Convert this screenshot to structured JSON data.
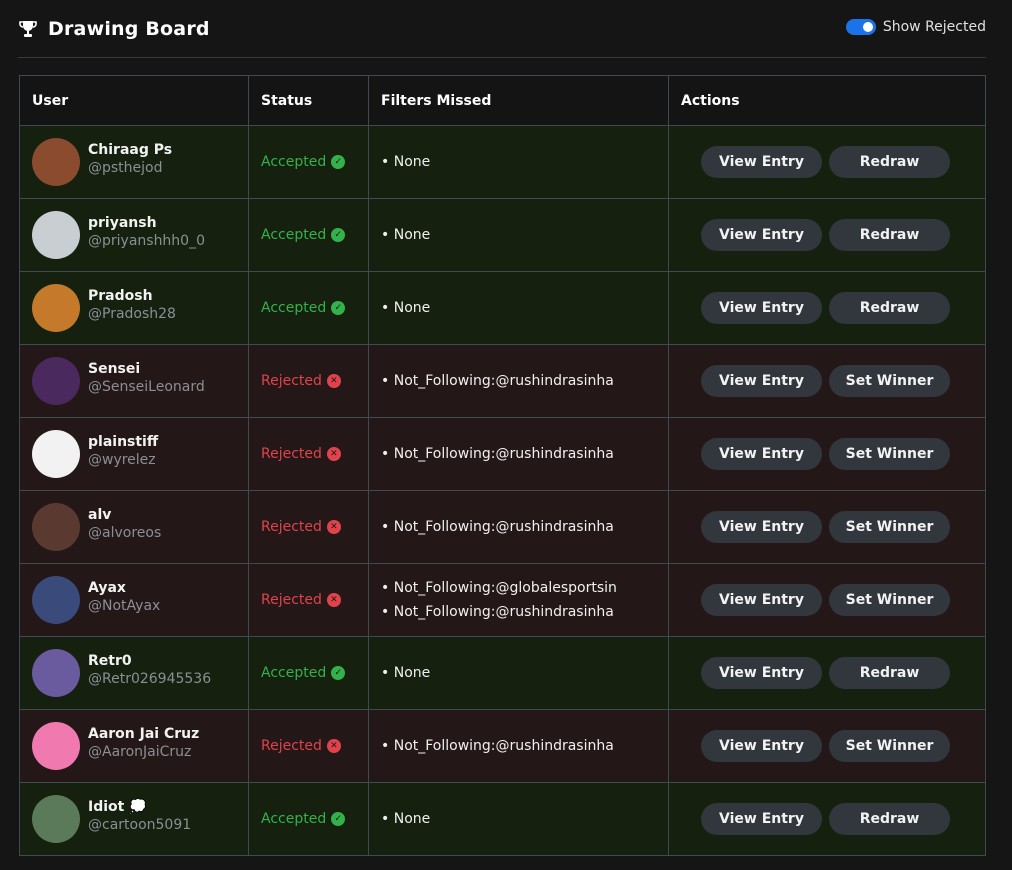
{
  "header": {
    "title": "Drawing Board",
    "toggle_label": "Show Rejected",
    "toggle_on": true
  },
  "columns": [
    "User",
    "Status",
    "Filters Missed",
    "Actions"
  ],
  "rows": [
    {
      "name": "Chiraag Ps",
      "handle": "@psthejod",
      "status": "Accepted",
      "filters": [
        "None"
      ],
      "view_label": "View Entry",
      "action_label": "Redraw",
      "avatar_color": "#8a4b2e"
    },
    {
      "name": "priyansh",
      "handle": "@priyanshhh0_0",
      "status": "Accepted",
      "filters": [
        "None"
      ],
      "view_label": "View Entry",
      "action_label": "Redraw",
      "avatar_color": "#c9ced3"
    },
    {
      "name": "Pradosh",
      "handle": "@Pradosh28",
      "status": "Accepted",
      "filters": [
        "None"
      ],
      "view_label": "View Entry",
      "action_label": "Redraw",
      "avatar_color": "#c47a2a"
    },
    {
      "name": "Sensei",
      "handle": "@SenseiLeonard",
      "status": "Rejected",
      "filters": [
        "Not_Following:@rushindrasinha"
      ],
      "view_label": "View Entry",
      "action_label": "Set Winner",
      "avatar_color": "#4a2a5e"
    },
    {
      "name": "plainstiff",
      "handle": "@wyrelez",
      "status": "Rejected",
      "filters": [
        "Not_Following:@rushindrasinha"
      ],
      "view_label": "View Entry",
      "action_label": "Set Winner",
      "avatar_color": "#f2f2f2"
    },
    {
      "name": "alv",
      "handle": "@alvoreos",
      "status": "Rejected",
      "filters": [
        "Not_Following:@rushindrasinha"
      ],
      "view_label": "View Entry",
      "action_label": "Set Winner",
      "avatar_color": "#5a3a30"
    },
    {
      "name": "Ayax",
      "handle": "@NotAyax",
      "status": "Rejected",
      "filters": [
        "Not_Following:@globalesportsin",
        "Not_Following:@rushindrasinha"
      ],
      "view_label": "View Entry",
      "action_label": "Set Winner",
      "avatar_color": "#3a4a7a"
    },
    {
      "name": "Retr0",
      "handle": "@Retr026945536",
      "status": "Accepted",
      "filters": [
        "None"
      ],
      "view_label": "View Entry",
      "action_label": "Redraw",
      "avatar_color": "#6a5a9e"
    },
    {
      "name": "Aaron Jai Cruz",
      "handle": "@AaronJaiCruz",
      "status": "Rejected",
      "filters": [
        "Not_Following:@rushindrasinha"
      ],
      "view_label": "View Entry",
      "action_label": "Set Winner",
      "avatar_color": "#f07ab0"
    },
    {
      "name": "Idiot 💭",
      "handle": "@cartoon5091",
      "status": "Accepted",
      "filters": [
        "None"
      ],
      "view_label": "View Entry",
      "action_label": "Redraw",
      "avatar_color": "#5a7a5a"
    }
  ],
  "colors": {
    "accepted": "#33b14a",
    "rejected": "#e0434b",
    "toggle": "#1a73e8"
  }
}
